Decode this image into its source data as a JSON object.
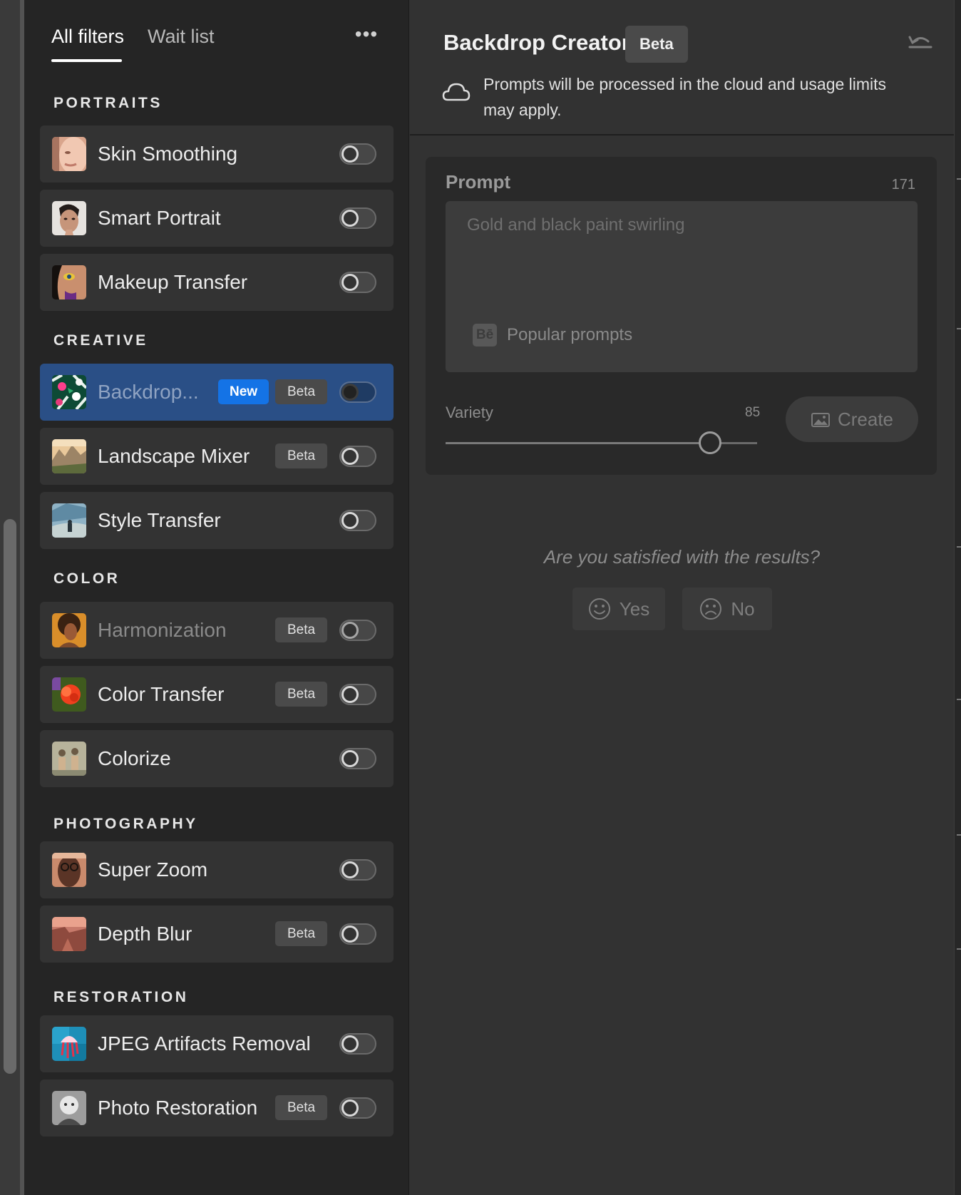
{
  "tabs": {
    "all_filters": "All filters",
    "wait_list": "Wait list",
    "more": "•••"
  },
  "sections": {
    "portraits": "PORTRAITS",
    "creative": "CREATIVE",
    "color": "COLOR",
    "photography": "PHOTOGRAPHY",
    "restoration": "RESTORATION"
  },
  "filters": {
    "skin_smoothing": {
      "label": "Skin Smoothing",
      "enabled": false,
      "icon": "face-photo-icon"
    },
    "smart_portrait": {
      "label": "Smart Portrait",
      "enabled": false,
      "icon": "portrait-photo-icon"
    },
    "makeup_transfer": {
      "label": "Makeup Transfer",
      "enabled": false,
      "icon": "makeup-photo-icon"
    },
    "backdrop": {
      "label": "Backdrop...",
      "badge_new": "New",
      "badge_beta": "Beta",
      "enabled": false,
      "selected": true,
      "icon": "floral-pattern-icon"
    },
    "landscape_mixer": {
      "label": "Landscape Mixer",
      "badge_beta": "Beta",
      "enabled": false,
      "icon": "landscape-photo-icon"
    },
    "style_transfer": {
      "label": "Style Transfer",
      "enabled": false,
      "icon": "painting-photo-icon"
    },
    "harmonization": {
      "label": "Harmonization",
      "badge_beta": "Beta",
      "enabled": false,
      "icon": "woman-photo-icon"
    },
    "color_transfer": {
      "label": "Color Transfer",
      "badge_beta": "Beta",
      "enabled": false,
      "icon": "flower-photo-icon"
    },
    "colorize": {
      "label": "Colorize",
      "enabled": false,
      "icon": "vintage-photo-icon"
    },
    "super_zoom": {
      "label": "Super Zoom",
      "enabled": false,
      "icon": "man-glasses-photo-icon"
    },
    "depth_blur": {
      "label": "Depth Blur",
      "badge_beta": "Beta",
      "enabled": false,
      "icon": "canyon-photo-icon"
    },
    "jpeg_artifacts": {
      "label": "JPEG Artifacts Removal",
      "enabled": false,
      "icon": "jellyfish-photo-icon"
    },
    "photo_restoration": {
      "label": "Photo Restoration",
      "badge_beta": "Beta",
      "enabled": false,
      "icon": "child-photo-icon"
    }
  },
  "detail": {
    "title": "Backdrop Creator",
    "badge": "Beta",
    "cloud_note": "Prompts will be processed in the cloud and usage limits may apply.",
    "prompt": {
      "label": "Prompt",
      "count": "171",
      "placeholder": "Gold and black paint swirling",
      "popular_prompts": "Popular prompts",
      "be_icon_text": "Bē"
    },
    "variety": {
      "label": "Variety",
      "value": "85",
      "level": 0.85
    },
    "create_label": "Create",
    "feedback": {
      "question": "Are you satisfied with the results?",
      "yes": "Yes",
      "no": "No"
    }
  },
  "colors": {
    "accent": "#1473e6",
    "selected_row": "#2a4f86",
    "panel": "#252525",
    "surface": "#323232"
  }
}
